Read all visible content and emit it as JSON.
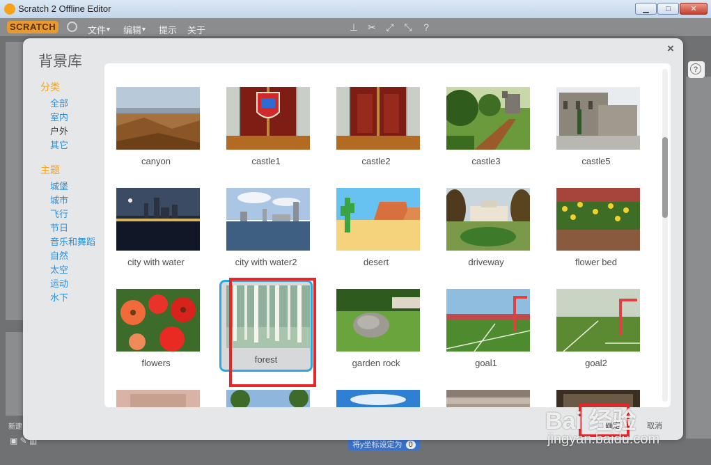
{
  "window": {
    "title": "Scratch 2 Offline Editor",
    "minimize": "▁",
    "maximize": "□",
    "close": "✕"
  },
  "menubar": {
    "logo": "SCRATCH",
    "items": [
      "文件",
      "编辑",
      "提示",
      "关于"
    ]
  },
  "dialog": {
    "title": "背景库",
    "close": "×",
    "ok_label": "确定",
    "cancel_label": "取消"
  },
  "sidebar": {
    "category_title": "分类",
    "categories": [
      "全部",
      "室内",
      "户外",
      "其它"
    ],
    "selected_category": "户外",
    "theme_title": "主题",
    "themes": [
      "城堡",
      "城市",
      "飞行",
      "节日",
      "音乐和舞蹈",
      "自然",
      "太空",
      "运动",
      "水下"
    ]
  },
  "backdrops": [
    {
      "name": "canyon"
    },
    {
      "name": "castle1"
    },
    {
      "name": "castle2"
    },
    {
      "name": "castle3"
    },
    {
      "name": "castle5"
    },
    {
      "name": "city with water"
    },
    {
      "name": "city with water2"
    },
    {
      "name": "desert"
    },
    {
      "name": "driveway"
    },
    {
      "name": "flower bed"
    },
    {
      "name": "flowers"
    },
    {
      "name": "forest"
    },
    {
      "name": "garden rock"
    },
    {
      "name": "goal1"
    },
    {
      "name": "goal2"
    }
  ],
  "selected_backdrop": "forest",
  "background": {
    "left_label": "新建",
    "block_text": "将y坐标设定为",
    "block_value": "0"
  },
  "watermark": {
    "logo": "Bai 经验",
    "url": "jingyan.baidu.com"
  },
  "colors": {
    "accent": "#f7a21b",
    "link": "#2c8fdc",
    "selection": "#29a8e0",
    "annotation": "#e8262a"
  }
}
